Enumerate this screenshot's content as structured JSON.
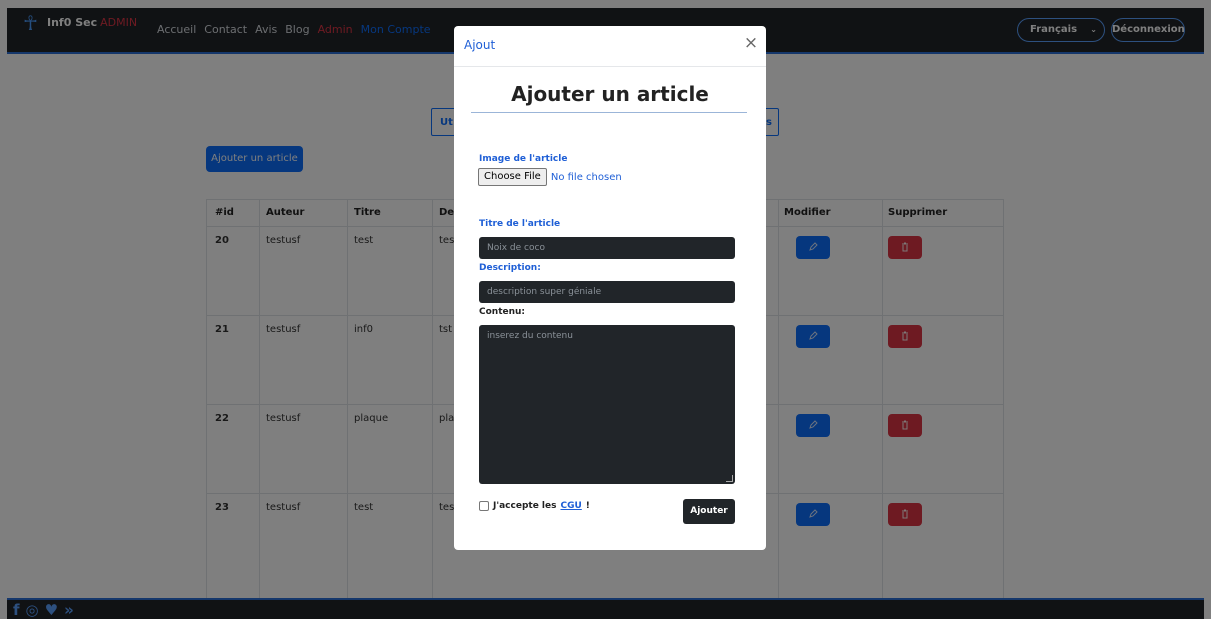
{
  "navbar": {
    "brand_name": "Inf0 Sec",
    "brand_admin": "ADMIN",
    "links": [
      "Accueil",
      "Contact",
      "Avis",
      "Blog",
      "Admin",
      "Mon Compte"
    ],
    "language": "Français",
    "logout": "Déconnexion",
    "accent": "#0d6efd",
    "admin_color": "#dc3545"
  },
  "main": {
    "tab_left": "Ut",
    "tab_right": "s",
    "add_article_button": "Ajouter un article",
    "table": {
      "headers": [
        "#id",
        "Auteur",
        "Titre",
        "De",
        "Modifier",
        "Supprimer"
      ],
      "rows": [
        {
          "id": "20",
          "author": "testusf",
          "title": "test",
          "desc": "tes"
        },
        {
          "id": "21",
          "author": "testusf",
          "title": "inf0",
          "desc": "tst"
        },
        {
          "id": "22",
          "author": "testusf",
          "title": "plaque",
          "desc": "pla"
        },
        {
          "id": "23",
          "author": "testusf",
          "title": "test",
          "desc": "tes"
        }
      ]
    }
  },
  "modal": {
    "title": "Ajout",
    "close_icon": "close-icon",
    "heading": "Ajouter un article",
    "image_label": "Image de l'article",
    "choose_file": "Choose File",
    "file_status": "No file chosen",
    "title_label": "Titre de l'article",
    "title_placeholder": "Noix de coco",
    "description_label": "Description:",
    "description_placeholder": "description super géniale",
    "content_label": "Contenu:",
    "content_placeholder": "inserez du contenu",
    "accept_prefix": "J'accepte les",
    "cgu": "CGU",
    "accept_suffix": "!",
    "submit": "Ajouter"
  },
  "footer": {
    "icons": [
      "facebook-icon",
      "instagram-icon",
      "twitter-icon",
      "rss-icon"
    ]
  }
}
